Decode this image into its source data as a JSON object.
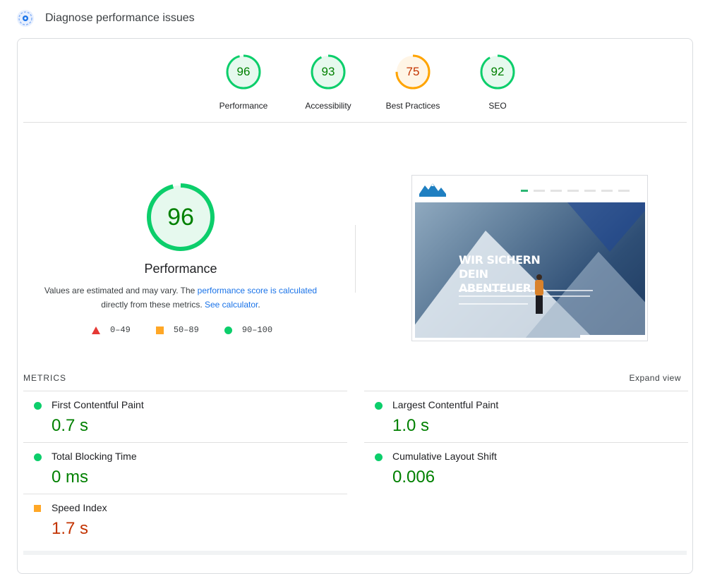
{
  "header": {
    "title": "Diagnose performance issues",
    "icon": "lighthouse-icon"
  },
  "categories": [
    {
      "label": "Performance",
      "score": "96",
      "color": "#0cce6b",
      "text_color": "#008000",
      "fill": "#e6f9ee"
    },
    {
      "label": "Accessibility",
      "score": "93",
      "color": "#0cce6b",
      "text_color": "#008000",
      "fill": "#e6f9ee"
    },
    {
      "label": "Best Practices",
      "score": "75",
      "color": "#ffa400",
      "text_color": "#c33300",
      "fill": "#fff5e6"
    },
    {
      "label": "SEO",
      "score": "92",
      "color": "#0cce6b",
      "text_color": "#008000",
      "fill": "#e6f9ee"
    }
  ],
  "performance": {
    "score": "96",
    "title": "Performance",
    "desc_prefix": "Values are estimated and may vary. The ",
    "desc_link1": "performance score is calculated",
    "desc_middle": " directly from these metrics. ",
    "desc_link2": "See calculator",
    "desc_suffix": "."
  },
  "legend": [
    {
      "range": "0–49",
      "shape": "triangle",
      "color": "#e53935"
    },
    {
      "range": "50–89",
      "shape": "square",
      "color": "#ffa726"
    },
    {
      "range": "90–100",
      "shape": "circle",
      "color": "#0cce6b"
    }
  ],
  "screenshot": {
    "headline_line1": "WIR SICHERN DEIN",
    "headline_line2": "ABENTEUER."
  },
  "metrics_section": {
    "label": "METRICS",
    "expand_label": "Expand view"
  },
  "metrics": [
    {
      "name": "First Contentful Paint",
      "value": "0.7 s",
      "status": "good"
    },
    {
      "name": "Largest Contentful Paint",
      "value": "1.0 s",
      "status": "good"
    },
    {
      "name": "Total Blocking Time",
      "value": "0 ms",
      "status": "good"
    },
    {
      "name": "Cumulative Layout Shift",
      "value": "0.006",
      "status": "good"
    },
    {
      "name": "Speed Index",
      "value": "1.7 s",
      "status": "average"
    }
  ]
}
